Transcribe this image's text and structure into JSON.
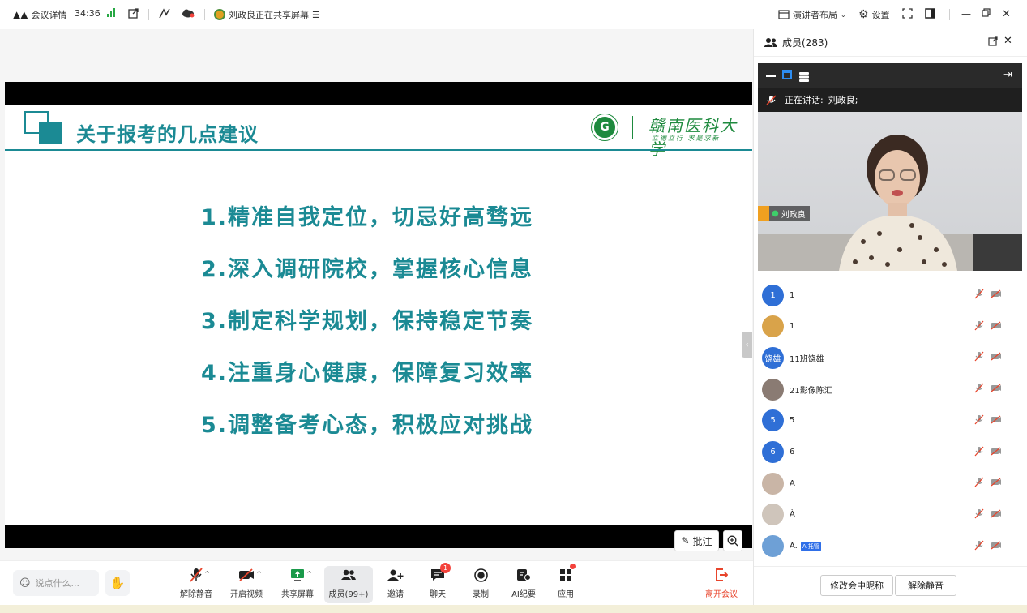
{
  "topbar": {
    "meeting_info": "会议详情",
    "timer": "34:36",
    "sharing_status": "刘政良正在共享屏幕",
    "layout": "演讲者布局",
    "settings": "设置"
  },
  "slide": {
    "title": "关于报考的几点建议",
    "school_name": "赣南医科大学",
    "school_motto": "立德立行 求是求新",
    "points": [
      "1.精准自我定位，切忌好高骛远",
      "2.深入调研院校，掌握核心信息",
      "3.制定科学规划，保持稳定节奏",
      "4.注重身心健康，保障复习效率",
      "5.调整备考心态，积极应对挑战"
    ]
  },
  "annotate": {
    "label": "批注"
  },
  "toolbar": {
    "chat_placeholder": "说点什么...",
    "tools": [
      {
        "label": "解除静音"
      },
      {
        "label": "开启视频"
      },
      {
        "label": "共享屏幕"
      },
      {
        "label": "成员(99+)"
      },
      {
        "label": "邀请"
      },
      {
        "label": "聊天",
        "badge": "1"
      },
      {
        "label": "录制"
      },
      {
        "label": "AI纪要"
      },
      {
        "label": "应用"
      }
    ],
    "leave": "离开会议"
  },
  "panel": {
    "title": "成员(283)",
    "speaking_label": "正在讲话:",
    "speaking_name": "刘政良;",
    "video_name": "刘政良",
    "members": [
      {
        "avatar_text": "1",
        "name": "1",
        "color": "#2f6fd6"
      },
      {
        "avatar_text": "",
        "name": "1",
        "color": "#d9a34a"
      },
      {
        "avatar_text": "饶雄",
        "name": "11班饶雄",
        "color": "#2f6fd6"
      },
      {
        "avatar_text": "",
        "name": "21影像陈汇",
        "color": "#8a7b73"
      },
      {
        "avatar_text": "5",
        "name": "5",
        "color": "#2f6fd6"
      },
      {
        "avatar_text": "6",
        "name": "6",
        "color": "#2f6fd6"
      },
      {
        "avatar_text": "",
        "name": "A",
        "color": "#c9b5a6"
      },
      {
        "avatar_text": "",
        "name": "À",
        "color": "#cfc5bb"
      },
      {
        "avatar_text": "",
        "name": "A.",
        "color": "#6ea0d6",
        "tag": "AI托管"
      }
    ],
    "rename_button": "修改会中昵称",
    "unmute_button": "解除静音"
  },
  "colors": {
    "accent": "#1b8a94",
    "school_green": "#1e8a3e",
    "leave_red": "#e8452c"
  }
}
